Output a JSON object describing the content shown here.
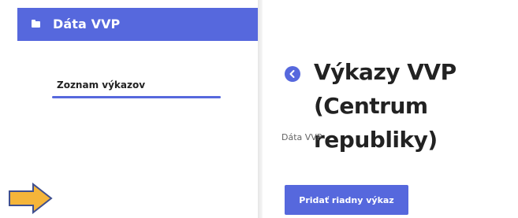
{
  "sidebar": {
    "title": "Dáta VVP",
    "title_icon": "folder-icon",
    "items": [
      {
        "label": "Zoznam výkazov",
        "active": true
      }
    ]
  },
  "main": {
    "title": "Výkazy VVP (Centrum republiky)",
    "breadcrumb": "Dáta VVP",
    "add_button_label": "Pridať riadny výkaz",
    "back_icon": "chevron-left-icon"
  },
  "annotation": {
    "icon": "arrow-right-icon"
  },
  "colors": {
    "accent": "#5668dd",
    "arrow_fill": "#f5b53a",
    "arrow_stroke": "#3f4f8f",
    "text": "#222222",
    "muted": "#666666"
  }
}
